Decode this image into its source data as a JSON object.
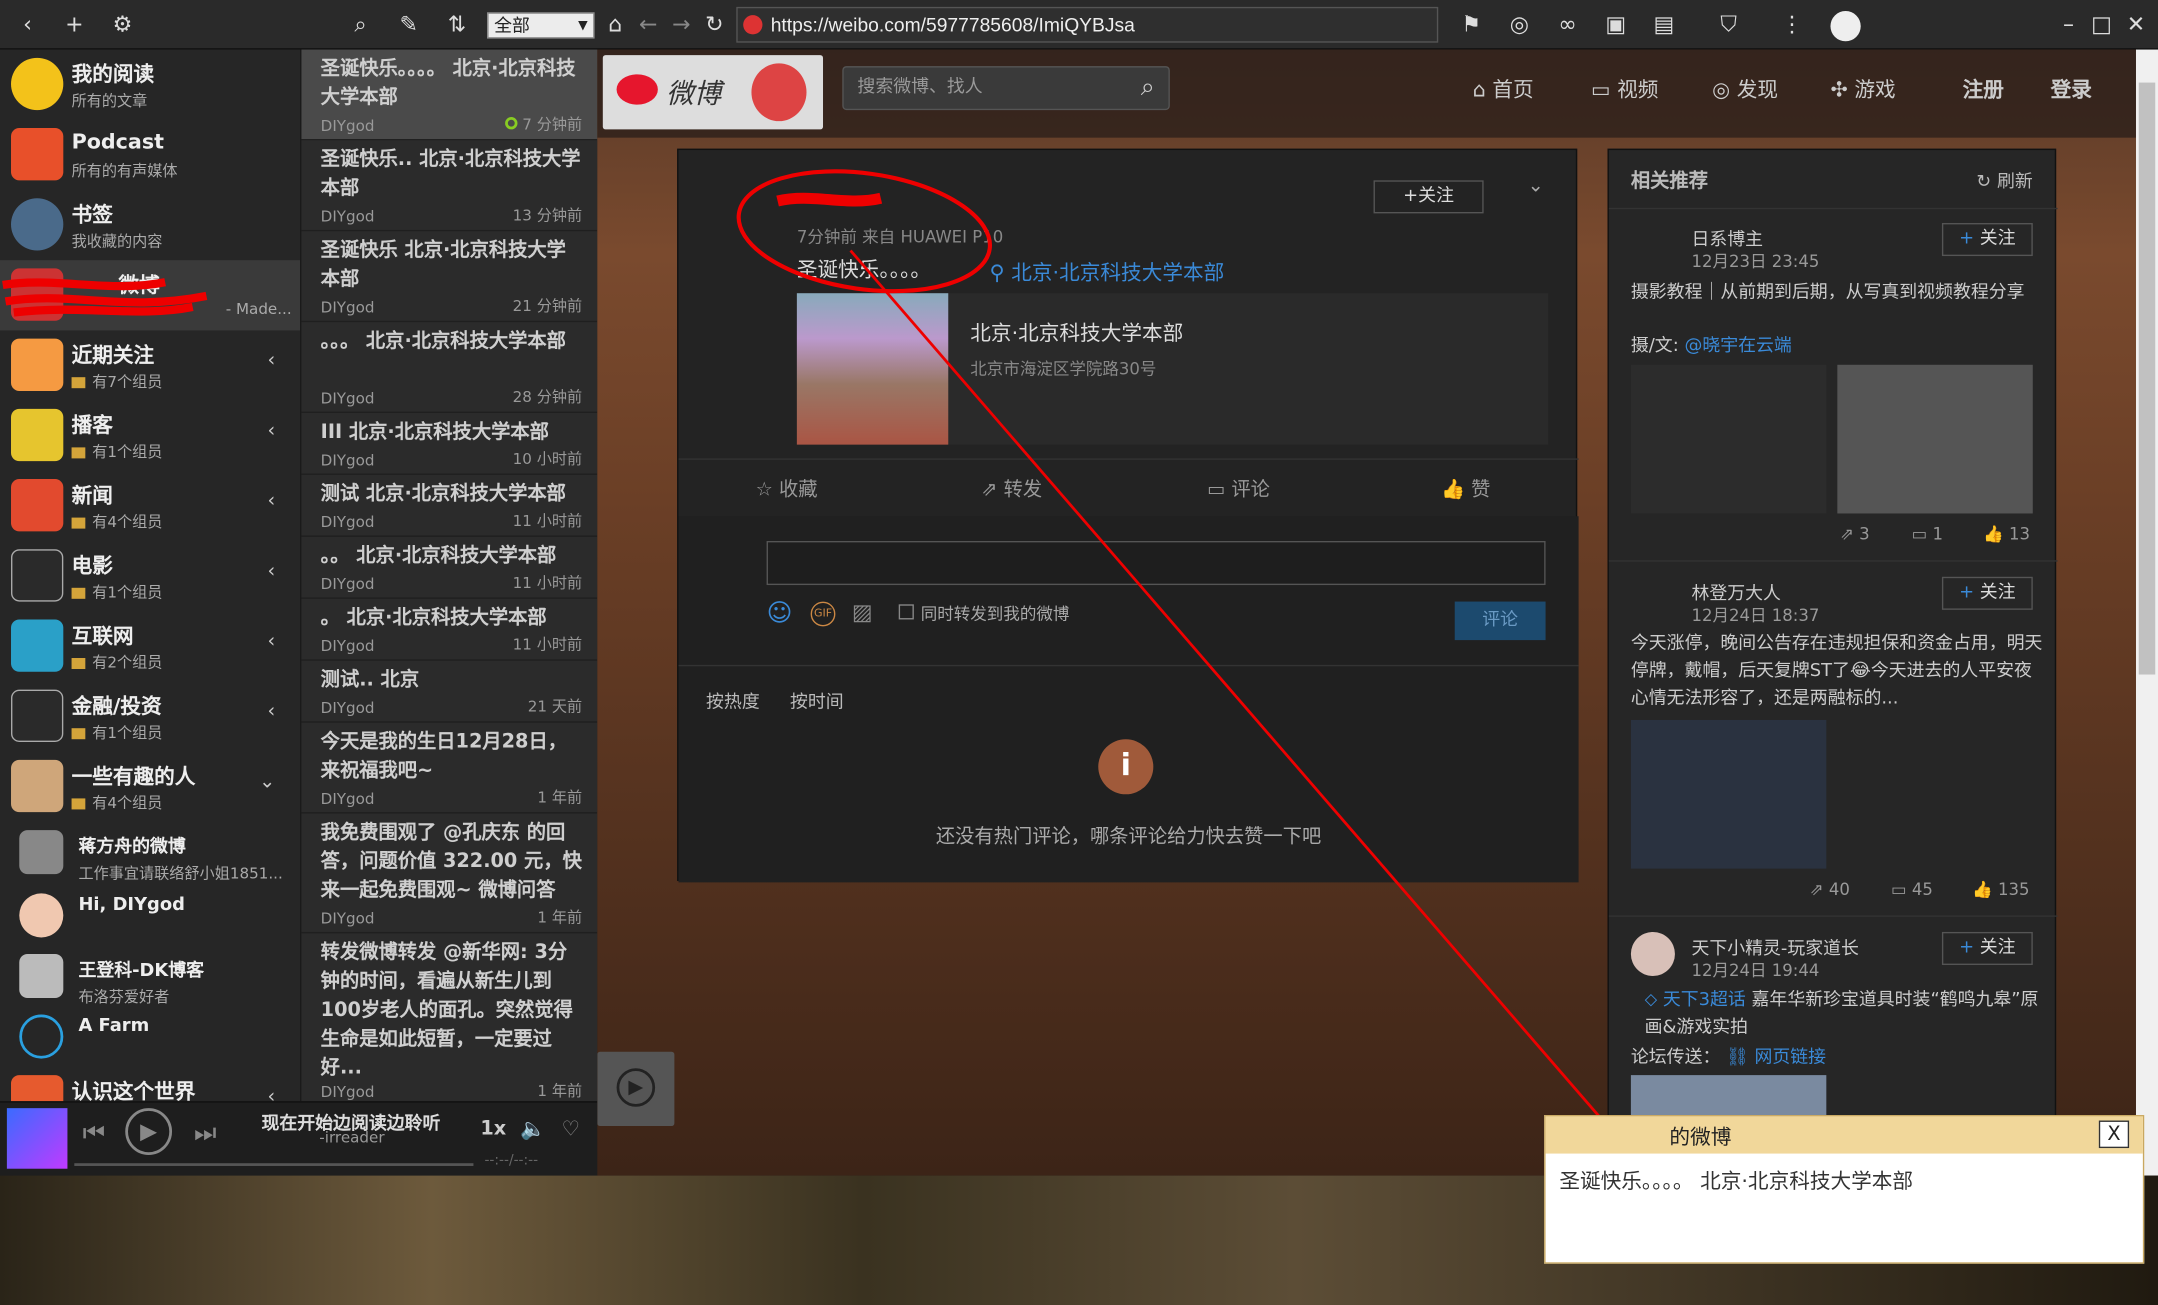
{
  "toolbar": {
    "scope": "全部",
    "url": "https://weibo.com/5977785608/ImiQYBJsa"
  },
  "sources": [
    {
      "name": "我的阅读",
      "sub": "所有的文章",
      "color": "#f3c21a"
    },
    {
      "name": "Podcast",
      "sub": "所有的有声媒体",
      "color": "#e8502a"
    },
    {
      "name": "书签",
      "sub": "我收藏的内容",
      "color": "#4a6a8a"
    },
    {
      "name": "微博",
      "sub": "- Made...",
      "color": "#c33"
    },
    {
      "name": "近期关注",
      "sub": "有7个组员",
      "color": "#f59a42"
    },
    {
      "name": "播客",
      "sub": "有1个组员",
      "color": "#e6c52e"
    },
    {
      "name": "新闻",
      "sub": "有4个组员",
      "color": "#e24a2e"
    },
    {
      "name": "电影",
      "sub": "有1个组员",
      "color": "#2a2a2a"
    },
    {
      "name": "互联网",
      "sub": "有2个组员",
      "color": "#2aa0c8"
    },
    {
      "name": "金融/投资",
      "sub": "有1个组员",
      "color": "#2a2a2a"
    },
    {
      "name": "一些有趣的人",
      "sub": "有4个组员",
      "color": "#cfa67a"
    },
    {
      "name": "蒋方舟的微博",
      "sub": "工作事宜请联络舒小姐1851...",
      "color": "#888"
    },
    {
      "name": "Hi, DIYgod",
      "sub": "",
      "color": "#f0c8b0"
    },
    {
      "name": "王登科-DK博客",
      "sub": "布洛芬爱好者",
      "color": "#bbb"
    },
    {
      "name": "A Farm",
      "sub": "",
      "color": "#2a2a2a"
    },
    {
      "name": "认识这个世界",
      "sub": "",
      "color": "#e65a2e"
    }
  ],
  "items": [
    {
      "title": "圣诞快乐。。。。 北京·北京科技大学本部",
      "author": "DIYgod",
      "time": "7 分钟前"
    },
    {
      "title": "圣诞快乐.. 北京·北京科技大学本部",
      "author": "DIYgod",
      "time": "13 分钟前"
    },
    {
      "title": "圣诞快乐 北京·北京科技大学本部",
      "author": "DIYgod",
      "time": "21 分钟前"
    },
    {
      "title": "。。。 北京·北京科技大学本部",
      "author": "DIYgod",
      "time": "28 分钟前"
    },
    {
      "title": "III 北京·北京科技大学本部",
      "author": "DIYgod",
      "time": "10 小时前"
    },
    {
      "title": "测试 北京·北京科技大学本部",
      "author": "DIYgod",
      "time": "11 小时前"
    },
    {
      "title": "。。 北京·北京科技大学本部",
      "author": "DIYgod",
      "time": "11 小时前"
    },
    {
      "title": "。 北京·北京科技大学本部",
      "author": "DIYgod",
      "time": "11 小时前"
    },
    {
      "title": "测试.. 北京",
      "author": "DIYgod",
      "time": "21 天前"
    },
    {
      "title": "今天是我的生日12月28日，来祝福我吧~",
      "author": "DIYgod",
      "time": "1 年前"
    },
    {
      "title": "我免费围观了 @孔庆东 的回答，问题价值 322.00 元，快来一起免费围观~ 微博问答",
      "author": "DIYgod",
      "time": "1 年前"
    },
    {
      "title": "转发微博转发 @新华网: 3分钟的时间，看遍从新生儿到100岁老人的面孔。突然觉得生命是如此短暂，一定要过好...",
      "author": "DIYgod",
      "time": "1 年前"
    }
  ],
  "player": {
    "title": "现在开始边阅读边聆听",
    "sub": "-irreader",
    "speed": "1x",
    "time": "--:--/--:--"
  },
  "weibo": {
    "logo": "微博",
    "search_placeholder": "搜索微博、找人",
    "nav": [
      "首页",
      "视频",
      "发现",
      "游戏",
      "注册",
      "登录"
    ],
    "post": {
      "meta": "7分钟前 来自 HUAWEI P10",
      "text": "圣诞快乐。。。。",
      "location": "北京·北京科技大学本部",
      "follow": "+关注",
      "place_title": "北京·北京科技大学本部",
      "place_addr": "北京市海淀区学院路30号"
    },
    "actions": [
      "收藏",
      "转发",
      "评论",
      "赞"
    ],
    "comment": {
      "repost_label": "同时转发到我的微博",
      "submit": "评论",
      "sort_hot": "按热度",
      "sort_time": "按时间",
      "empty": "还没有热门评论，哪条评论给力快去赞一下吧"
    },
    "related": {
      "title": "相关推荐",
      "refresh": "刷新",
      "follow": "关注",
      "cards": [
        {
          "name": "日系博主",
          "date": "12月23日 23:45",
          "text": "摄影教程｜从前期到后期，从写真到视频教程分享",
          "sub": "摄/文: ",
          "mention": "@晓宇在云端",
          "stats": [
            "3",
            "1",
            "13"
          ]
        },
        {
          "name": "林登万大人",
          "date": "12月24日 18:37",
          "text": "今天涨停，晚间公告存在违规担保和资金占用，明天停牌，戴帽，后天复牌ST了😂今天进去的人平安夜心情无法形容了，还是两融标的...",
          "stats": [
            "40",
            "45",
            "135"
          ]
        },
        {
          "name": "天下小精灵-玩家道长",
          "date": "12月24日 19:44",
          "topic": "天下3超话",
          "text": "嘉年华新珍宝道具时装“鹤鸣九皋”原画&游戏实拍",
          "sub": "论坛传送：",
          "link": "网页链接"
        }
      ]
    }
  },
  "popup": {
    "title": "的微博",
    "close": "X",
    "body": "圣诞快乐。。。。 北京·北京科技大学本部"
  }
}
